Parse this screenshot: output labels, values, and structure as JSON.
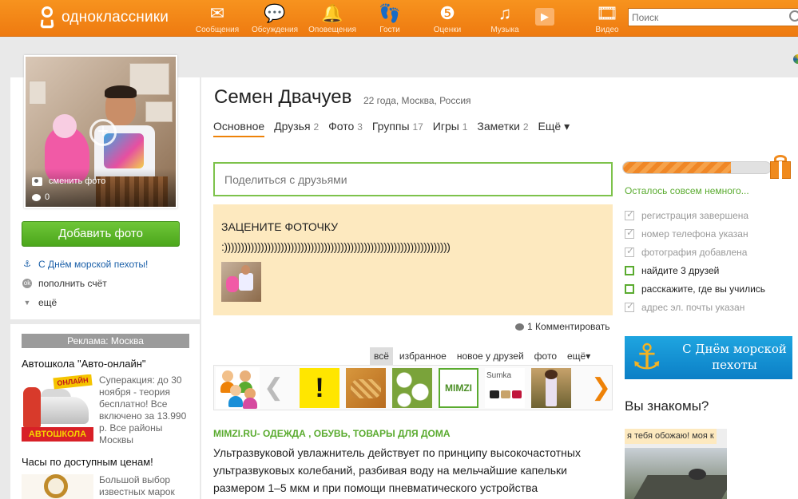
{
  "app": {
    "logo_text": "одноклассники"
  },
  "nav": [
    {
      "label": "Сообщения",
      "icon": "envelope-icon"
    },
    {
      "label": "Обсуждения",
      "icon": "chat-bubbles-icon"
    },
    {
      "label": "Оповещения",
      "icon": "bell-icon"
    },
    {
      "label": "Гости",
      "icon": "footprints-icon"
    },
    {
      "label": "Оценки",
      "icon": "rating-5-icon"
    },
    {
      "label": "Музыка",
      "icon": "music-note-icon"
    },
    {
      "label": "Видео",
      "icon": "film-icon"
    }
  ],
  "search": {
    "placeholder": "Поиск"
  },
  "profile": {
    "name": "Семен Двачуев",
    "meta": "22 года, Москва, Россия",
    "change_photo_label": "сменить фото",
    "photo_comments": "0",
    "add_photo_label": "Добавить фото"
  },
  "side_links": [
    {
      "label": "С Днём морской пехоты!",
      "icon": "anchor-icon"
    },
    {
      "label": "пополнить счёт",
      "icon": "coin-icon"
    },
    {
      "label": "ещё",
      "icon": "triangle-down-icon"
    }
  ],
  "ads": {
    "header": "Реклама: Москва",
    "items": [
      {
        "title": "Автошкола \"Авто-онлайн\"",
        "text": "Суперакция: до 30 ноября - теория бесплатно! Все включено за 13.990 р. Все районы Москвы",
        "img_top": "ОНЛАЙН",
        "img_bottom": "АВТОШКОЛА"
      },
      {
        "title": "Часы по доступным ценам!",
        "text": "Большой выбор известных марок"
      }
    ]
  },
  "tabs": [
    {
      "label": "Основное",
      "count": "",
      "active": true
    },
    {
      "label": "Друзья",
      "count": "2"
    },
    {
      "label": "Фото",
      "count": "3"
    },
    {
      "label": "Группы",
      "count": "17"
    },
    {
      "label": "Игры",
      "count": "1"
    },
    {
      "label": "Заметки",
      "count": "2"
    },
    {
      "label": "Ещё ▾",
      "count": ""
    }
  ],
  "share": {
    "placeholder": "Поделиться с друзьями"
  },
  "post": {
    "title": "ЗАЦЕНИТЕ ФОТОЧКУ",
    "text": ":))))))))))))))))))))))))))))))))))))))))))))))))))))))))))))))))))))",
    "comment_count": "1",
    "comment_label": "Комментировать"
  },
  "feed_filters": [
    {
      "label": "всё",
      "active": true
    },
    {
      "label": "избранное"
    },
    {
      "label": "новое у друзей"
    },
    {
      "label": "фото"
    },
    {
      "label": "ещё▾"
    }
  ],
  "carousel": {
    "mimzi_label": "MIMZI",
    "sumka_label": "Sumka",
    "warn_label": "!"
  },
  "feed_ad": {
    "site": "MIMZI.RU- ОДЕЖДА , ОБУВЬ, ТОВАРЫ ДЛЯ ДОМА",
    "body": "Ультразвуковой увлажнитель действует по принципу высокочастотных ультразвуковых колебаний, разбивая воду на мельчайшие капельки размером 1–5 мкм и при помощи пневматического устройства"
  },
  "progress": {
    "fraction": 0.73,
    "caption": "Осталось совсем немного...",
    "items": [
      {
        "label": "регистрация завершена",
        "done": true
      },
      {
        "label": "номер телефона указан",
        "done": true
      },
      {
        "label": "фотография добавлена",
        "done": true
      },
      {
        "label": "найдите 3 друзей",
        "done": false
      },
      {
        "label": "расскажите, где вы учились",
        "done": false
      },
      {
        "label": "адрес эл. почты указан",
        "done": true
      }
    ]
  },
  "marine_banner": {
    "text": "С Днём морской пехоты"
  },
  "people_you_may_know": {
    "title": "Вы знакомы?",
    "card_caption": "я тебя обожаю! моя к"
  },
  "colors": {
    "brand_orange": "#ee8208",
    "accent_green": "#5aab2f",
    "link_blue": "#1a5fa8"
  }
}
